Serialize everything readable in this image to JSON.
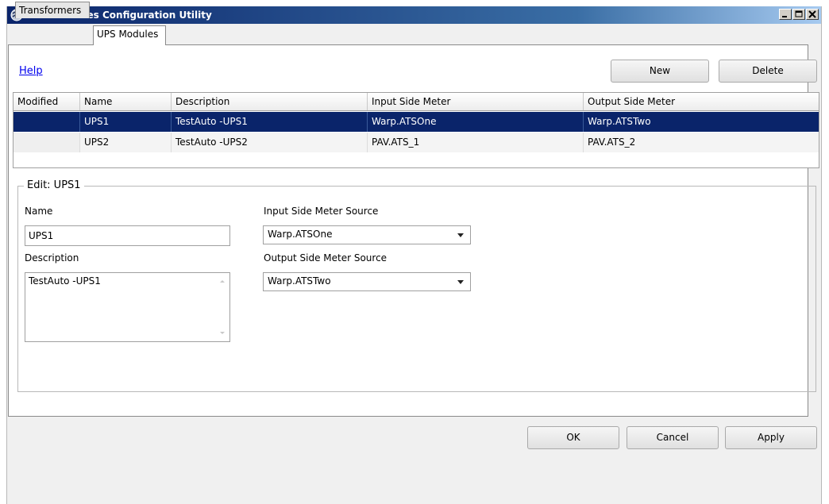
{
  "window": {
    "title": "Power Losses Configuration Utility"
  },
  "tabs": [
    {
      "label": "Transformers",
      "active": false
    },
    {
      "label": "UPS Modules",
      "active": true
    }
  ],
  "toolbar": {
    "help_label": "Help",
    "new_label": "New",
    "delete_label": "Delete"
  },
  "grid": {
    "columns": [
      "Modified",
      "Name",
      "Description",
      "Input Side Meter",
      "Output Side Meter"
    ],
    "rows": [
      {
        "modified": "",
        "name": "UPS1",
        "description": "TestAuto -UPS1",
        "input": "Warp.ATSOne",
        "output": "Warp.ATSTwo",
        "selected": true
      },
      {
        "modified": "",
        "name": "UPS2",
        "description": "TestAuto -UPS2",
        "input": "PAV.ATS_1",
        "output": "PAV.ATS_2",
        "selected": false
      }
    ]
  },
  "edit": {
    "legend": "Edit: UPS1",
    "name_label": "Name",
    "name_value": "UPS1",
    "description_label": "Description",
    "description_value": "TestAuto -UPS1",
    "input_label": "Input Side Meter Source",
    "input_value": "Warp.ATSOne",
    "output_label": "Output Side Meter Source",
    "output_value": "Warp.ATSTwo"
  },
  "footer": {
    "ok_label": "OK",
    "cancel_label": "Cancel",
    "apply_label": "Apply"
  },
  "colors": {
    "selection": "#0a246a",
    "link": "#0000ee",
    "titlebar": "#0a246a"
  }
}
